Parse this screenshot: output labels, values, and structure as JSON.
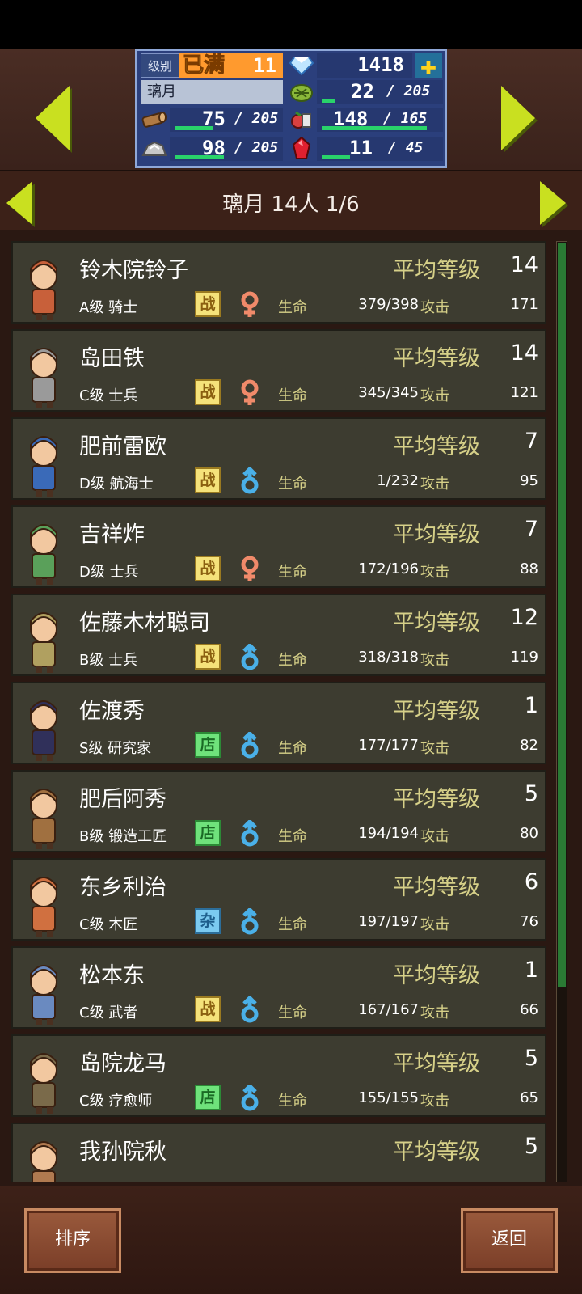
{
  "resources": {
    "level_label": "级别",
    "level_max": "已满",
    "level_value": "11",
    "gems": "1418",
    "town_name": "璃月",
    "grass": "22",
    "grass_max": "205",
    "grass_fill": 0.11,
    "wood": "75",
    "wood_max": "205",
    "wood_fill": 0.37,
    "food": "148",
    "food_max": "165",
    "food_fill": 0.9,
    "ore": "98",
    "ore_max": "205",
    "ore_fill": 0.48,
    "ruby": "11",
    "ruby_max": "45",
    "ruby_fill": 0.24
  },
  "page_title": "璃月  14人 1/6",
  "labels": {
    "avg": "平均等级",
    "hp": "生命",
    "atk": "攻击"
  },
  "characters": [
    {
      "name": "铃木院铃子",
      "level": "14",
      "rank": "A级 骑士",
      "job": "战",
      "gender": "female",
      "hp": "379/398",
      "atk": "171"
    },
    {
      "name": "岛田铁",
      "level": "14",
      "rank": "C级 士兵",
      "job": "战",
      "gender": "female",
      "hp": "345/345",
      "atk": "121"
    },
    {
      "name": "肥前雷欧",
      "level": "7",
      "rank": "D级 航海士",
      "job": "战",
      "gender": "male",
      "hp": "1/232",
      "atk": "95"
    },
    {
      "name": "吉祥炸",
      "level": "7",
      "rank": "D级 士兵",
      "job": "战",
      "gender": "female",
      "hp": "172/196",
      "atk": "88"
    },
    {
      "name": "佐藤木材聪司",
      "level": "12",
      "rank": "B级 士兵",
      "job": "战",
      "gender": "male",
      "hp": "318/318",
      "atk": "119"
    },
    {
      "name": "佐渡秀",
      "level": "1",
      "rank": "S级 研究家",
      "job": "店",
      "gender": "male",
      "hp": "177/177",
      "atk": "82"
    },
    {
      "name": "肥后阿秀",
      "level": "5",
      "rank": "B级 锻造工匠",
      "job": "店",
      "gender": "male",
      "hp": "194/194",
      "atk": "80"
    },
    {
      "name": "东乡利治",
      "level": "6",
      "rank": "C级 木匠",
      "job": "杂",
      "gender": "male",
      "hp": "197/197",
      "atk": "76"
    },
    {
      "name": "松本东",
      "level": "1",
      "rank": "C级 武者",
      "job": "战",
      "gender": "male",
      "hp": "167/167",
      "atk": "66"
    },
    {
      "name": "岛院龙马",
      "level": "5",
      "rank": "C级 疗愈师",
      "job": "店",
      "gender": "male",
      "hp": "155/155",
      "atk": "65"
    },
    {
      "name": "我孙院秋",
      "level": "5",
      "rank": "",
      "job": "",
      "gender": "",
      "hp": "",
      "atk": ""
    }
  ],
  "buttons": {
    "sort": "排序",
    "back": "返回"
  }
}
